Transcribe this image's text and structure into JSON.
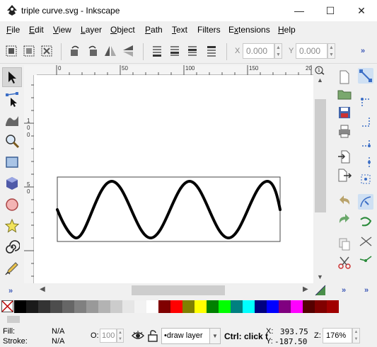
{
  "window": {
    "title": "triple curve.svg - Inkscape",
    "controls": {
      "minimize": "—",
      "maximize": "☐",
      "close": "✕"
    }
  },
  "menu": {
    "items": [
      {
        "label": "File",
        "mnemonic": "F",
        "rest": "ile"
      },
      {
        "label": "Edit",
        "mnemonic": "E",
        "rest": "dit"
      },
      {
        "label": "View",
        "mnemonic": "V",
        "rest": "iew"
      },
      {
        "label": "Layer",
        "mnemonic": "L",
        "rest": "ayer"
      },
      {
        "label": "Object",
        "mnemonic": "O",
        "rest": "bject"
      },
      {
        "label": "Path",
        "mnemonic": "P",
        "rest": "ath"
      },
      {
        "label": "Text",
        "mnemonic": "T",
        "rest": "ext"
      },
      {
        "label": "Filters",
        "mnemonic": "",
        "rest": "Filters"
      },
      {
        "label": "Extensions",
        "mnemonic": "x",
        "rest": "tensions"
      },
      {
        "label": "Help",
        "mnemonic": "H",
        "rest": "elp"
      }
    ]
  },
  "toolbar": {
    "x_label": "X",
    "x_value": "0.000",
    "y_label": "Y",
    "y_value": "0.000",
    "more": "»"
  },
  "rulers": {
    "top_ticks": [
      "0",
      "50",
      "100",
      "150",
      "20"
    ],
    "left_ticks": [
      "1",
      "0",
      "0",
      "5",
      "0"
    ]
  },
  "toolbox": {
    "tools": [
      "selector-tool",
      "node-tool",
      "tweak-tool",
      "zoom-tool",
      "rectangle-tool",
      "box-3d-tool",
      "ellipse-tool",
      "star-tool",
      "spiral-tool",
      "pencil-tool"
    ],
    "active": "selector-tool",
    "more": "»"
  },
  "palette": {
    "colors": [
      "#000000",
      "#1a1a1a",
      "#333333",
      "#4d4d4d",
      "#666666",
      "#808080",
      "#999999",
      "#b3b3b3",
      "#cccccc",
      "#e6e6e6",
      "#f2f2f2",
      "#ffffff",
      "#800000",
      "#ff0000",
      "#808000",
      "#ffff00",
      "#008000",
      "#00ff00",
      "#008080",
      "#00ffff",
      "#000080",
      "#0000ff",
      "#800080",
      "#ff00ff",
      "#550000",
      "#800000",
      "#a00000"
    ]
  },
  "status": {
    "fill_label": "Fill:",
    "fill_value": "N/A",
    "stroke_label": "Stroke:",
    "stroke_value": "N/A",
    "opacity_label": "O:",
    "opacity_value": "100",
    "layer_value": "•draw layer",
    "message": "Ctrl: click t",
    "x_label": "X:",
    "x_value": "393.75",
    "y_label": "Y:",
    "y_value": "-187.50",
    "zoom_label": "Z:",
    "zoom_value": "176%"
  },
  "colors": {
    "accent": "#3a56b6",
    "curve": "#000000",
    "canvas": "#ffffff"
  }
}
